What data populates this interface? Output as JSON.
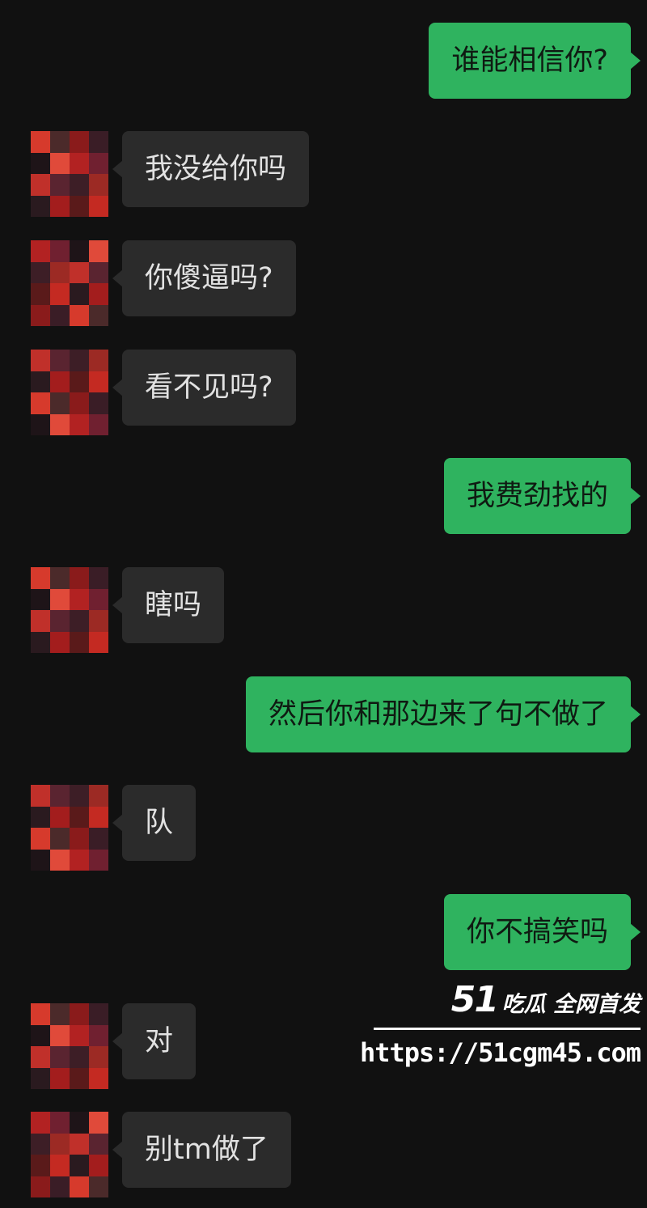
{
  "messages": [
    {
      "side": "out",
      "text": "谁能相信你?"
    },
    {
      "side": "in",
      "text": "我没给你吗"
    },
    {
      "side": "in",
      "text": "你傻逼吗?"
    },
    {
      "side": "in",
      "text": "看不见吗?"
    },
    {
      "side": "out",
      "text": "我费劲找的"
    },
    {
      "side": "in",
      "text": "瞎吗"
    },
    {
      "side": "out",
      "text": "然后你和那边来了句不做了"
    },
    {
      "side": "in",
      "text": "队"
    },
    {
      "side": "out",
      "text": "你不搞笑吗"
    },
    {
      "side": "in",
      "text": "对"
    },
    {
      "side": "in",
      "text": "别tm做了"
    }
  ],
  "watermark": {
    "number": "51",
    "text": "吃瓜 全网首发",
    "url": "https://51cgm45.com"
  },
  "colors": {
    "background": "#111111",
    "outgoing_bubble": "#2fb35f",
    "incoming_bubble": "#2b2b2b"
  },
  "avatar_icon": "pixelated-avatar-icon"
}
